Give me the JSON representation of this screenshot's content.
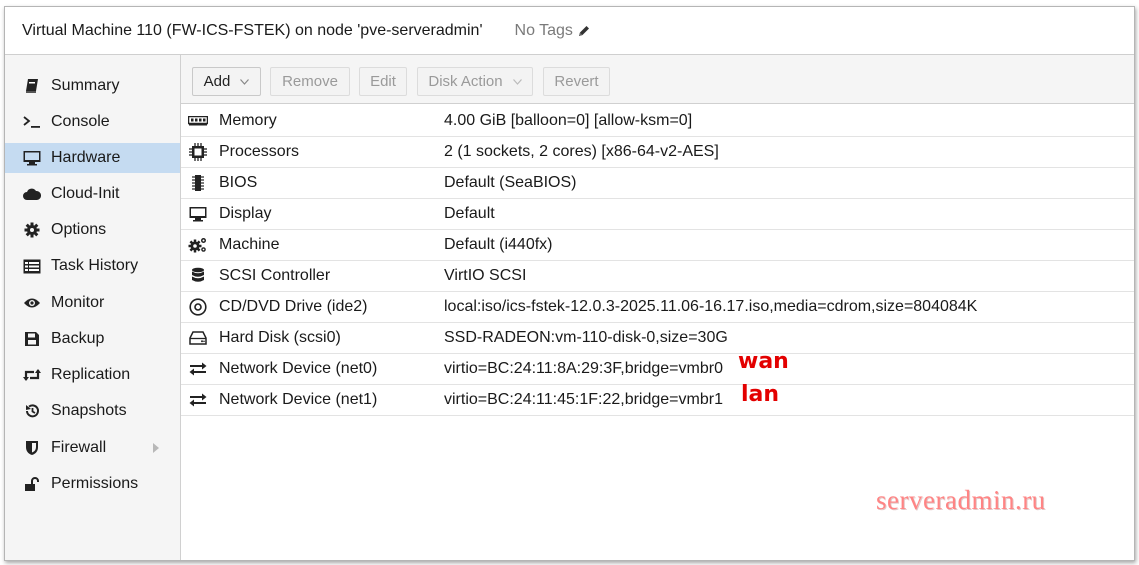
{
  "title": "Virtual Machine 110 (FW-ICS-FSTEK) on node 'pve-serveradmin'",
  "tags_label": "No Tags",
  "sidebar": {
    "items": [
      {
        "label": "Summary",
        "icon": "book-icon"
      },
      {
        "label": "Console",
        "icon": "terminal-icon"
      },
      {
        "label": "Hardware",
        "icon": "desktop-icon",
        "selected": true
      },
      {
        "label": "Cloud-Init",
        "icon": "cloud-icon"
      },
      {
        "label": "Options",
        "icon": "gear-icon"
      },
      {
        "label": "Task History",
        "icon": "list-icon"
      },
      {
        "label": "Monitor",
        "icon": "eye-icon"
      },
      {
        "label": "Backup",
        "icon": "floppy-icon"
      },
      {
        "label": "Replication",
        "icon": "retweet-icon"
      },
      {
        "label": "Snapshots",
        "icon": "history-icon"
      },
      {
        "label": "Firewall",
        "icon": "shield-icon"
      },
      {
        "label": "Permissions",
        "icon": "unlock-icon"
      }
    ]
  },
  "toolbar": {
    "add": "Add",
    "remove": "Remove",
    "edit": "Edit",
    "disk_action": "Disk Action",
    "revert": "Revert"
  },
  "hardware": [
    {
      "name": "Memory",
      "value": "4.00 GiB [balloon=0] [allow-ksm=0]",
      "icon": "memory-icon"
    },
    {
      "name": "Processors",
      "value": "2 (1 sockets, 2 cores) [x86-64-v2-AES]",
      "icon": "cpu-icon"
    },
    {
      "name": "BIOS",
      "value": "Default (SeaBIOS)",
      "icon": "chip-icon"
    },
    {
      "name": "Display",
      "value": "Default",
      "icon": "desktop-icon"
    },
    {
      "name": "Machine",
      "value": "Default (i440fx)",
      "icon": "gears-icon"
    },
    {
      "name": "SCSI Controller",
      "value": "VirtIO SCSI",
      "icon": "database-icon"
    },
    {
      "name": "CD/DVD Drive (ide2)",
      "value": "local:iso/ics-fstek-12.0.3-2025.11.06-16.17.iso,media=cdrom,size=804084K",
      "icon": "disc-icon"
    },
    {
      "name": "Hard Disk (scsi0)",
      "value": "SSD-RADEON:vm-110-disk-0,size=30G",
      "icon": "hdd-icon"
    },
    {
      "name": "Network Device (net0)",
      "value": "virtio=BC:24:11:8A:29:3F,bridge=vmbr0",
      "icon": "exchange-icon"
    },
    {
      "name": "Network Device (net1)",
      "value": "virtio=BC:24:11:45:1F:22,bridge=vmbr1",
      "icon": "exchange-icon"
    }
  ],
  "annotations": {
    "net0": "wan",
    "net1": "lan"
  },
  "watermark": "serveradmin.ru",
  "colors": {
    "selected_bg": "#c5dbf1",
    "annotation": "#e30000",
    "watermark": "#ff2020"
  }
}
